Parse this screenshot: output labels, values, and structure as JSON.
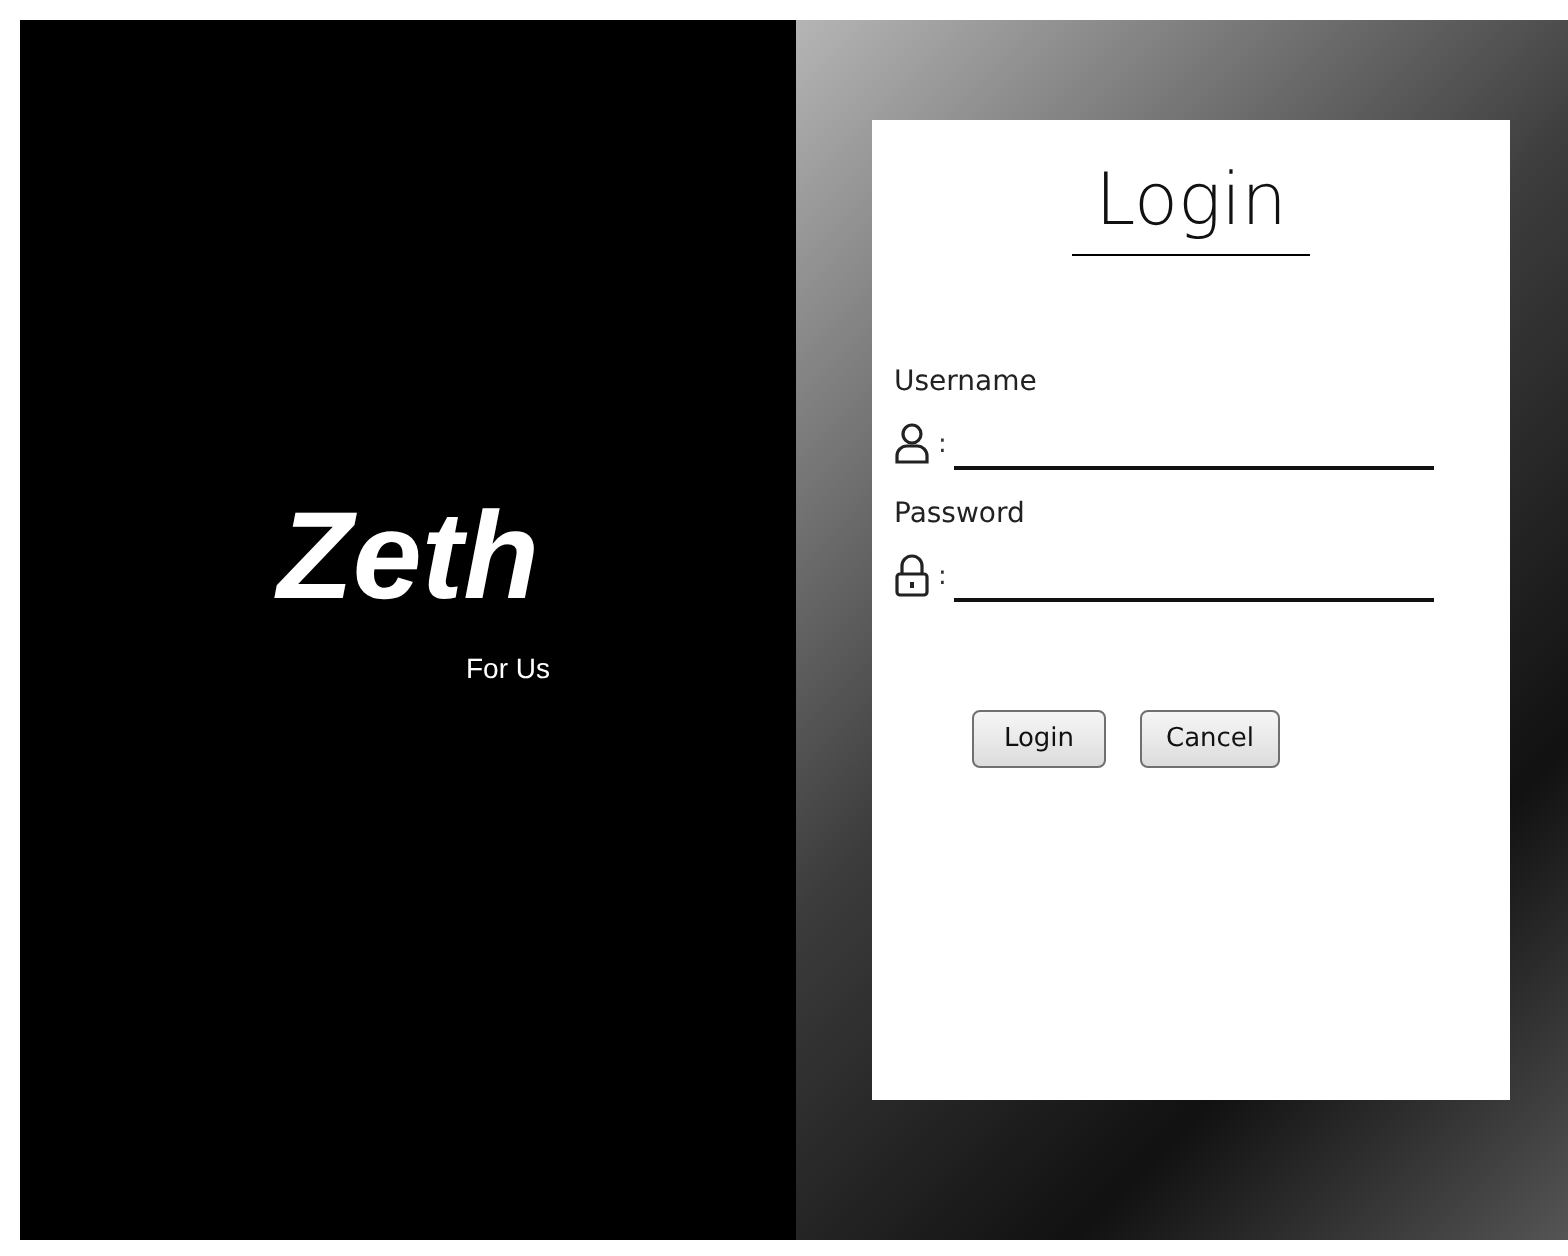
{
  "brand": {
    "name": "Zeth",
    "tagline": "For Us"
  },
  "form": {
    "title": "Login",
    "fields": [
      {
        "label": "Username",
        "kind": "user",
        "separator": ":"
      },
      {
        "label": "Password",
        "kind": "password",
        "separator": ":"
      }
    ],
    "buttons": [
      "Login",
      "Cancel"
    ]
  }
}
